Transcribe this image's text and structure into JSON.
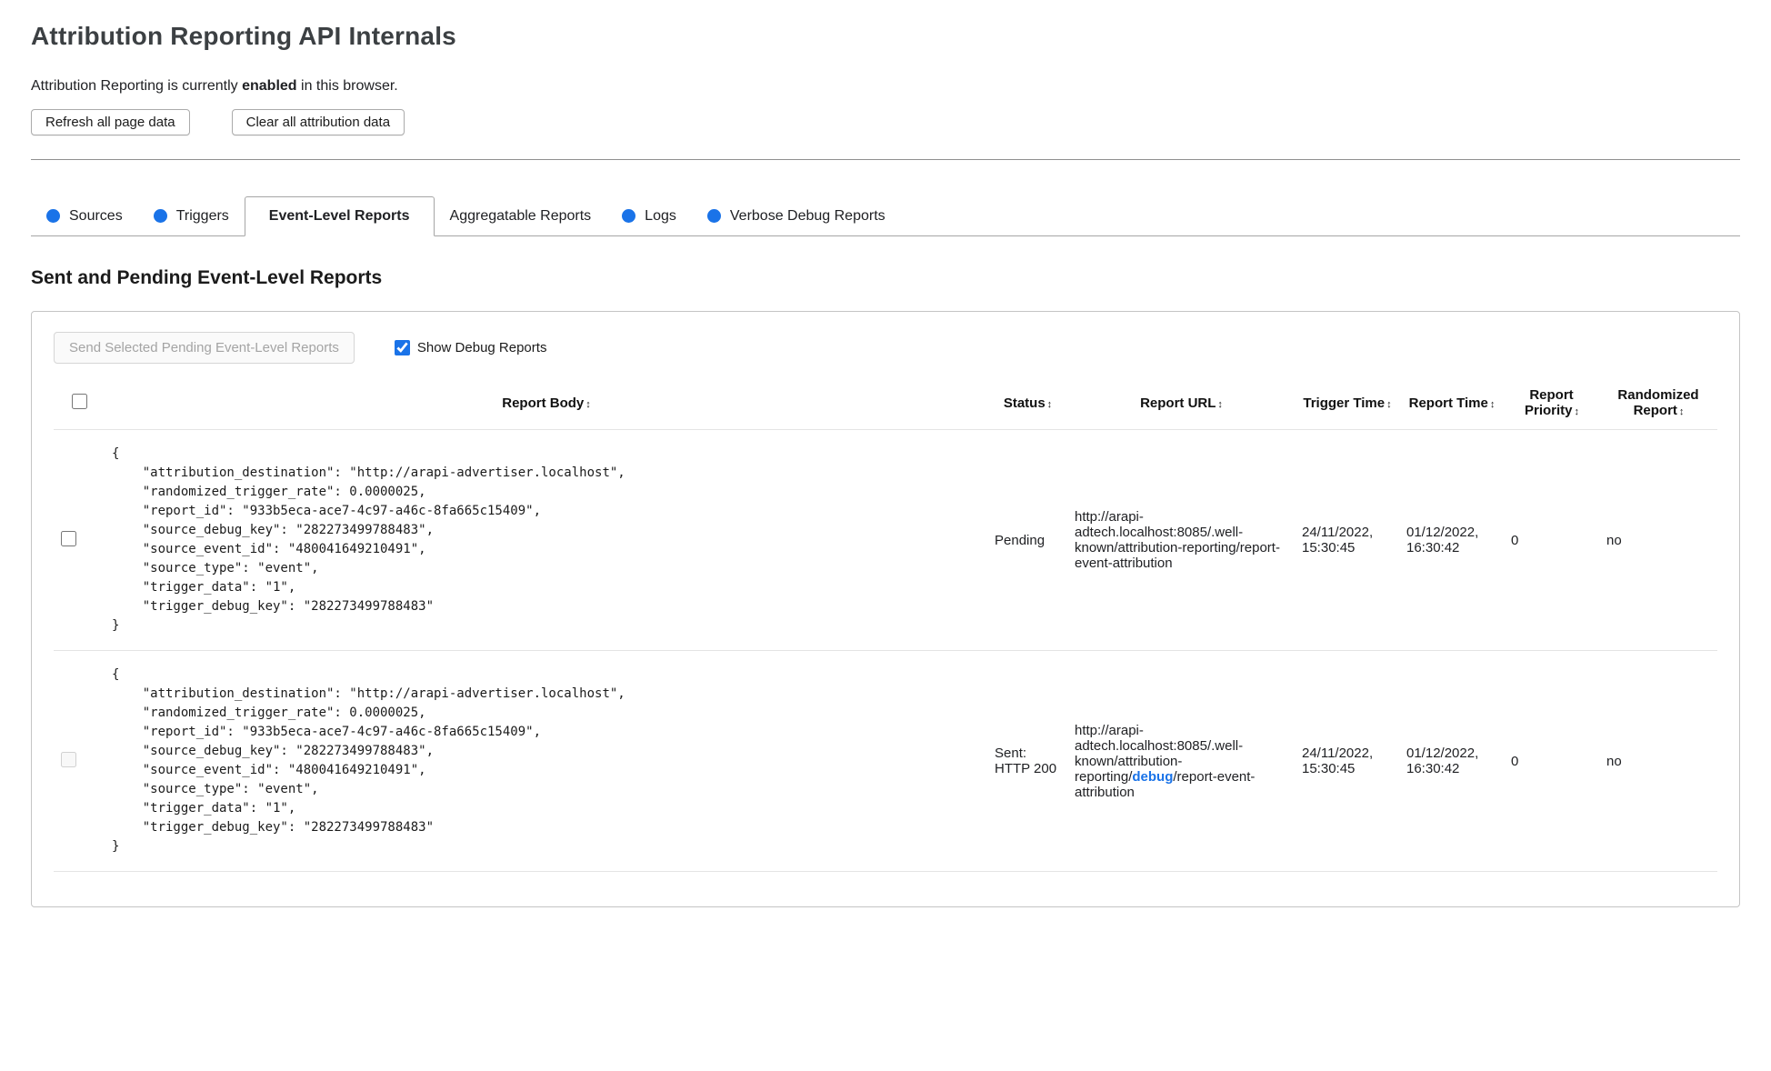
{
  "header": {
    "title": "Attribution Reporting API Internals",
    "status_prefix": "Attribution Reporting is currently ",
    "status_emphasis": "enabled",
    "status_suffix": " in this browser.",
    "refresh_button": "Refresh all page data",
    "clear_button": "Clear all attribution data"
  },
  "tabs": [
    {
      "label": "Sources",
      "has_dot": true,
      "active": false
    },
    {
      "label": "Triggers",
      "has_dot": true,
      "active": false
    },
    {
      "label": "Event-Level Reports",
      "has_dot": false,
      "active": true
    },
    {
      "label": "Aggregatable Reports",
      "has_dot": false,
      "active": false
    },
    {
      "label": "Logs",
      "has_dot": true,
      "active": false
    },
    {
      "label": "Verbose Debug Reports",
      "has_dot": true,
      "active": false
    }
  ],
  "section": {
    "heading": "Sent and Pending Event-Level Reports",
    "send_button": "Send Selected Pending Event-Level Reports",
    "send_button_enabled": false,
    "show_debug_label": "Show Debug Reports",
    "show_debug_checked": true
  },
  "table": {
    "sort_icon": "↕",
    "headers": [
      "Report Body",
      "Status",
      "Report URL",
      "Trigger Time",
      "Report Time",
      "Report Priority",
      "Randomized Report"
    ],
    "rows": [
      {
        "selected": false,
        "checkbox_enabled": true,
        "body": "{\n    \"attribution_destination\": \"http://arapi-advertiser.localhost\",\n    \"randomized_trigger_rate\": 0.0000025,\n    \"report_id\": \"933b5eca-ace7-4c97-a46c-8fa665c15409\",\n    \"source_debug_key\": \"282273499788483\",\n    \"source_event_id\": \"480041649210491\",\n    \"source_type\": \"event\",\n    \"trigger_data\": \"1\",\n    \"trigger_debug_key\": \"282273499788483\"\n}",
        "status": "Pending",
        "url_prefix": "http://arapi-adtech.localhost:8085/.well-known/attribution-reporting/",
        "url_debug_segment": "",
        "url_suffix": "report-event-attribution",
        "trigger_time": "24/11/2022, 15:30:45",
        "report_time": "01/12/2022, 16:30:42",
        "report_priority": "0",
        "randomized_report": "no"
      },
      {
        "selected": false,
        "checkbox_enabled": false,
        "body": "{\n    \"attribution_destination\": \"http://arapi-advertiser.localhost\",\n    \"randomized_trigger_rate\": 0.0000025,\n    \"report_id\": \"933b5eca-ace7-4c97-a46c-8fa665c15409\",\n    \"source_debug_key\": \"282273499788483\",\n    \"source_event_id\": \"480041649210491\",\n    \"source_type\": \"event\",\n    \"trigger_data\": \"1\",\n    \"trigger_debug_key\": \"282273499788483\"\n}",
        "status": "Sent: HTTP 200",
        "url_prefix": "http://arapi-adtech.localhost:8085/.well-known/attribution-reporting/",
        "url_debug_segment": "debug",
        "url_suffix": "/report-event-attribution",
        "trigger_time": "24/11/2022, 15:30:45",
        "report_time": "01/12/2022, 16:30:42",
        "report_priority": "0",
        "randomized_report": "no"
      }
    ]
  },
  "colors": {
    "accent_blue": "#1a73e8"
  }
}
